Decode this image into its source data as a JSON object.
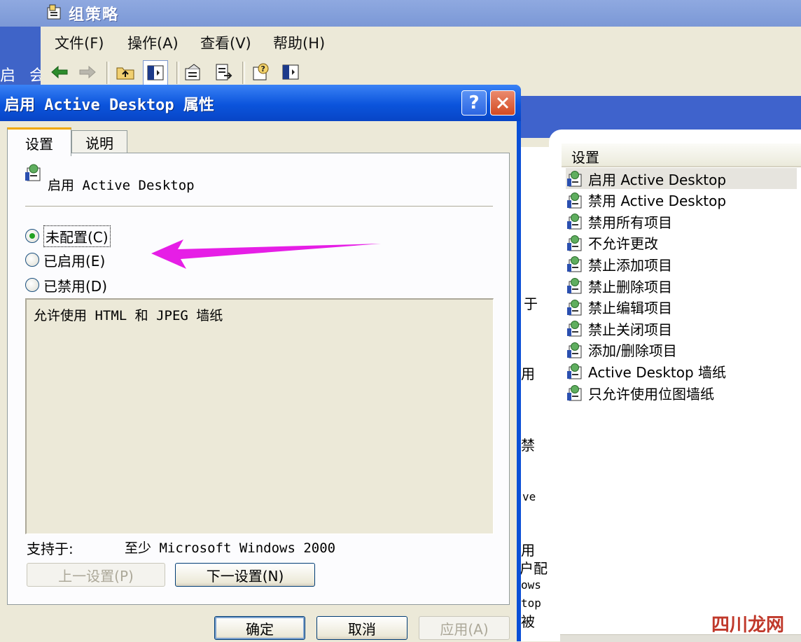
{
  "main_window": {
    "title": "组策略",
    "left_fragment": "启",
    "left_fragment2": "会",
    "menu": [
      {
        "label": "文件(F)"
      },
      {
        "label": "操作(A)"
      },
      {
        "label": "查看(V)"
      },
      {
        "label": "帮助(H)"
      }
    ],
    "toolbar_icons": [
      "back-icon",
      "forward-icon",
      "up-folder-icon",
      "show-hide-tree-icon",
      "properties-icon",
      "export-list-icon",
      "help-icon",
      "extended-view-icon"
    ],
    "middle_fragments": [
      "于",
      "用",
      "禁",
      "ve",
      "用",
      "户配",
      "ows",
      "top",
      "被"
    ],
    "list": {
      "header": "设置",
      "items": [
        {
          "label": "启用 Active Desktop",
          "selected": true
        },
        {
          "label": "禁用 Active Desktop",
          "selected": false
        },
        {
          "label": "禁用所有项目",
          "selected": false
        },
        {
          "label": "不允许更改",
          "selected": false
        },
        {
          "label": "禁止添加项目",
          "selected": false
        },
        {
          "label": "禁止删除项目",
          "selected": false
        },
        {
          "label": "禁止编辑项目",
          "selected": false
        },
        {
          "label": "禁止关闭项目",
          "selected": false
        },
        {
          "label": "添加/删除项目",
          "selected": false
        },
        {
          "label": "Active Desktop 墙纸",
          "selected": false
        },
        {
          "label": "只允许使用位图墙纸",
          "selected": false
        }
      ]
    }
  },
  "dialog": {
    "title": "启用 Active Desktop 属性",
    "help_button": "?",
    "close_button": "✕",
    "tabs": [
      {
        "label": "设置",
        "active": true
      },
      {
        "label": "说明",
        "active": false
      }
    ],
    "policy_name": "启用 Active Desktop",
    "options": [
      {
        "label": "未配置(C)",
        "checked": true
      },
      {
        "label": "已启用(E)",
        "checked": false
      },
      {
        "label": "已禁用(D)",
        "checked": false
      }
    ],
    "description": "允许使用 HTML 和 JPEG 墙纸",
    "supported_label": "支持于:",
    "supported_value": "至少 Microsoft Windows 2000",
    "prev_button": "上一设置(P)",
    "next_button": "下一设置(N)",
    "ok_button": "确定",
    "cancel_button": "取消",
    "apply_button": "应用(A)"
  },
  "annotation": {
    "color": "#e61ee6"
  },
  "watermark": "四川龙网"
}
